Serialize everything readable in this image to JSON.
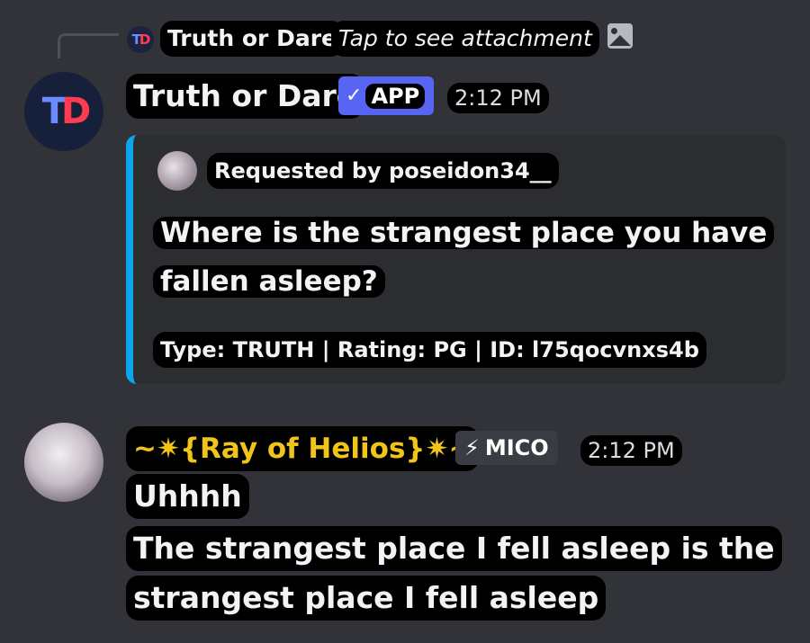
{
  "reply": {
    "author": "Truth or Dare",
    "avatar_text": [
      "T",
      "D"
    ],
    "text": "Tap to see attachment",
    "icon": "image-icon"
  },
  "message1": {
    "avatar_text": [
      "T",
      "D"
    ],
    "author": "Truth or Dare",
    "badge_check": "✓",
    "badge_label": "APP",
    "timestamp": "2:12 PM",
    "embed": {
      "accent_color": "#0ba5ec",
      "author": "Requested by poseidon34__",
      "description": "Where is the strangest place you have fallen asleep?",
      "footer": "Type: TRUTH | Rating: PG | ID: l75qocvnxs4b"
    }
  },
  "message2": {
    "author": "~✷{Ray of Helios}✷~",
    "author_color": "#f0c419",
    "badge_icon": "⚡",
    "badge_label": "MICO",
    "timestamp": "2:12 PM",
    "lines": [
      "Uhhhh",
      "The strangest place I fell asleep is the",
      "strangest place I fell asleep"
    ]
  }
}
